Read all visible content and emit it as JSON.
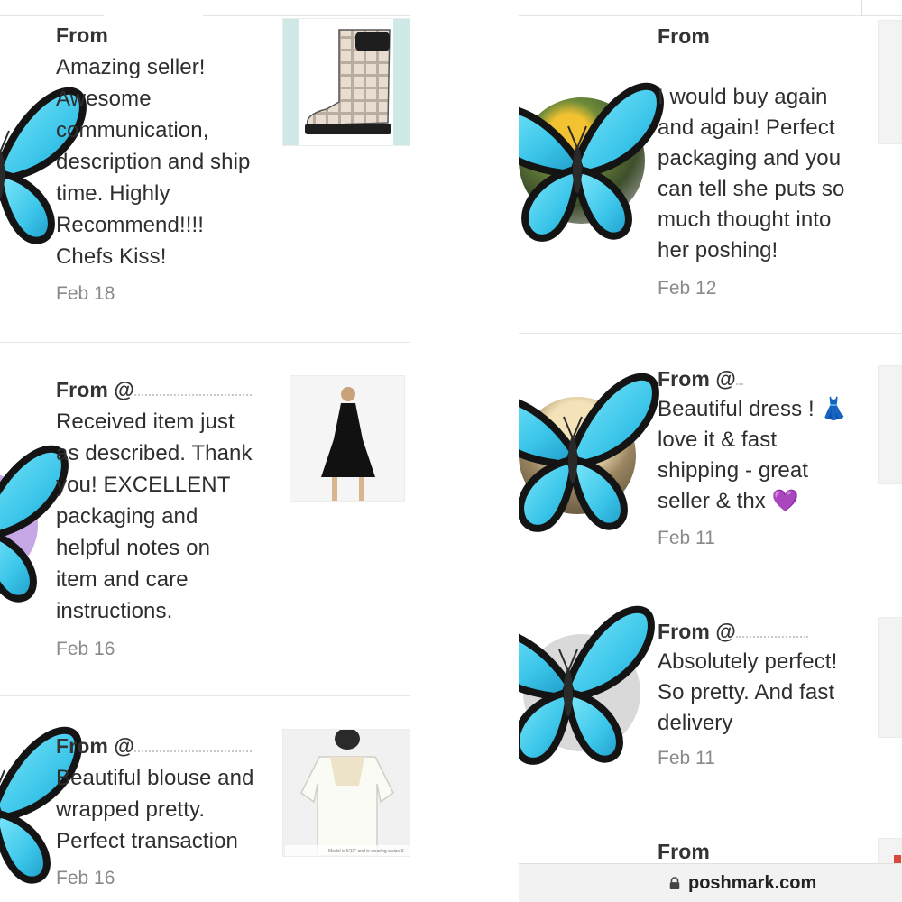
{
  "left_column": {
    "reviews": [
      {
        "from": "From",
        "lines": [
          "Amazing seller!",
          "Awesome",
          "communication,",
          "description and ship",
          "time. Highly",
          "Recommend!!!!",
          "Chefs Kiss!"
        ],
        "date": "Feb 18",
        "thumb_icon": "rain-boot-image"
      },
      {
        "from": "From @",
        "lines": [
          "Received item just",
          "as described. Thank",
          "you! EXCELLENT",
          "packaging and",
          "helpful notes on",
          "item and care",
          "instructions."
        ],
        "date": "Feb 16",
        "thumb_icon": "black-dress-image"
      },
      {
        "from": "From @",
        "lines": [
          "Beautiful blouse and",
          "wrapped pretty.",
          "Perfect transaction"
        ],
        "date": "Feb 16",
        "thumb_icon": "white-blouse-image",
        "thumb_caption": "Model is 5'10\" and is wearing a size S"
      }
    ]
  },
  "right_column": {
    "reviews": [
      {
        "from": "From",
        "lines": [
          "I would buy again",
          "and again! Perfect",
          "packaging and you",
          "can tell she puts so",
          "much thought into",
          "her poshing!"
        ],
        "date": "Feb 12"
      },
      {
        "from": "From @",
        "lines": [
          "Beautiful dress ! 👗",
          "love it & fast",
          "shipping - great",
          "seller & thx 💜"
        ],
        "date": "Feb 11"
      },
      {
        "from": "From @",
        "lines": [
          "Absolutely perfect!",
          "So pretty. And fast",
          "delivery"
        ],
        "date": "Feb 11"
      },
      {
        "from": "From",
        "lines": [],
        "date": ""
      }
    ]
  },
  "footer": {
    "url": "poshmark.com"
  },
  "colors": {
    "butterfly_blue": "#4fd3ef",
    "butterfly_edge": "#1b1b1b",
    "avatar_purple": "#c7a8e6",
    "avatar_gray": "#d9d9d9"
  }
}
